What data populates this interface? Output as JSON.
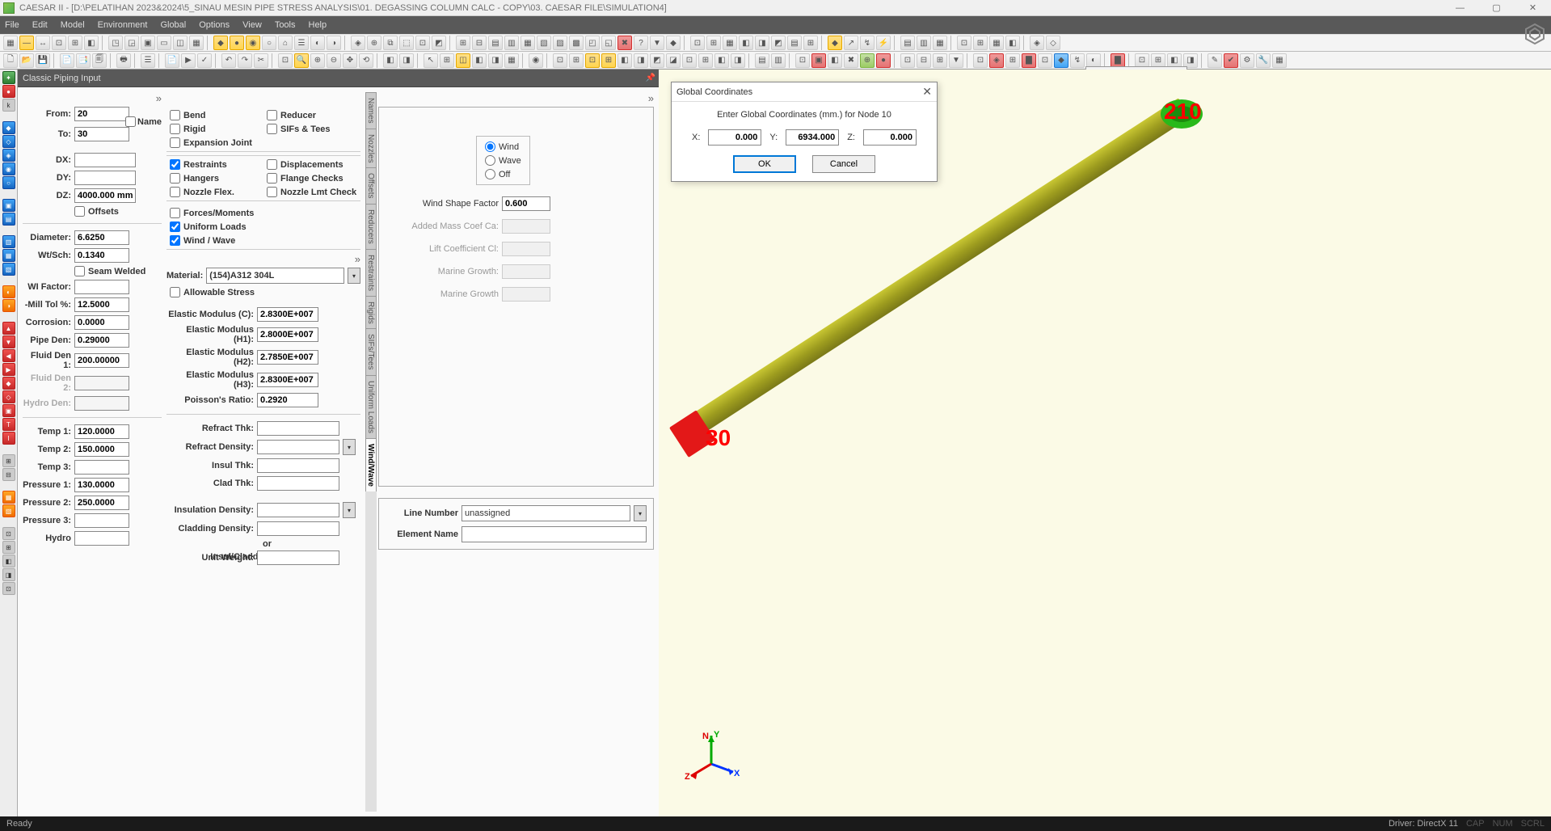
{
  "app": {
    "title": "CAESAR II - [D:\\PELATIHAN 2023&2024\\5_SINAU MESIN PIPE STRESS ANALYSIS\\01. DEGASSING COLUMN CALC - COPY\\03. CAESAR FILE\\SIMULATION4]"
  },
  "menu": [
    "File",
    "Edit",
    "Model",
    "Environment",
    "Global",
    "Options",
    "View",
    "Tools",
    "Help"
  ],
  "panel": {
    "title": "Classic Piping Input"
  },
  "from_to": {
    "from_lbl": "From:",
    "to_lbl": "To:",
    "from": "20",
    "to": "30",
    "name_lbl": "Name"
  },
  "deltas": {
    "dx_lbl": "DX:",
    "dy_lbl": "DY:",
    "dz_lbl": "DZ:",
    "dx": "",
    "dy": "",
    "dz": "4000.000 mm",
    "offsets_lbl": "Offsets"
  },
  "pipe": {
    "diameter_lbl": "Diameter:",
    "diameter": "6.6250",
    "wt_lbl": "Wt/Sch:",
    "wt": "0.1340",
    "seam_lbl": "Seam Welded",
    "wi_lbl": "WI Factor:",
    "wi": "",
    "mill_lbl": "-Mill Tol %:",
    "mill": "12.5000",
    "corr_lbl": "Corrosion:",
    "corr": "0.0000",
    "pden_lbl": "Pipe Den:",
    "pden": "0.29000",
    "fd1_lbl": "Fluid Den 1:",
    "fd1": "200.00000",
    "fd2_lbl": "Fluid Den 2:",
    "fd2": "",
    "hd_lbl": "Hydro Den:",
    "hd": ""
  },
  "tp": {
    "t1_lbl": "Temp 1:",
    "t1": "120.0000",
    "t2_lbl": "Temp 2:",
    "t2": "150.0000",
    "t3_lbl": "Temp 3:",
    "t3": "",
    "p1_lbl": "Pressure 1:",
    "p1": "130.0000",
    "p2_lbl": "Pressure 2:",
    "p2": "250.0000",
    "p3_lbl": "Pressure 3:",
    "p3": "",
    "hy_lbl": "Hydro",
    "hy": ""
  },
  "flags": {
    "bend": "Bend",
    "reducer": "Reducer",
    "rigid": "Rigid",
    "sifs": "SIFs & Tees",
    "exp": "Expansion Joint",
    "restraints": "Restraints",
    "disp": "Displacements",
    "hangers": "Hangers",
    "flange": "Flange Checks",
    "nozflex": "Nozzle Flex.",
    "nozlmt": "Nozzle Lmt Check",
    "forces": "Forces/Moments",
    "uloads": "Uniform Loads",
    "windwave": "Wind / Wave"
  },
  "material": {
    "lbl": "Material:",
    "val": "(154)A312 304L",
    "allow": "Allowable Stress",
    "ec_lbl": "Elastic Modulus (C):",
    "ec": "2.8300E+007",
    "eh1_lbl": "Elastic Modulus (H1):",
    "eh1": "2.8000E+007",
    "eh2_lbl": "Elastic Modulus (H2):",
    "eh2": "2.7850E+007",
    "eh3_lbl": "Elastic Modulus (H3):",
    "eh3": "2.8300E+007",
    "pr_lbl": "Poisson's Ratio:",
    "pr": "0.2920"
  },
  "ins": {
    "rt_lbl": "Refract Thk:",
    "rt": "",
    "rd_lbl": "Refract Density:",
    "rd": "",
    "it_lbl": "Insul Thk:",
    "it": "",
    "ct_lbl": "Clad Thk:",
    "ct": "",
    "id_lbl": "Insulation Density:",
    "id": "",
    "cd_lbl": "Cladding Density:",
    "cd": "",
    "or_lbl": "or",
    "ic_lbl": "Insul/Cladding",
    "uw_lbl": "Unit Weight:",
    "uw": ""
  },
  "side_tabs": [
    "Names",
    "Nozzles",
    "Offsets",
    "Reducers",
    "Restraints",
    "Rigids",
    "SIFs/Tees",
    "Uniform Loads",
    "Wind/Wave"
  ],
  "wind": {
    "r_wind": "Wind",
    "r_wave": "Wave",
    "r_off": "Off",
    "wsf_lbl": "Wind Shape Factor",
    "wsf": "0.600",
    "amc_lbl": "Added Mass Coef Ca:",
    "amc": "",
    "lc_lbl": "Lift Coefficient Cl:",
    "lc": "",
    "mg1_lbl": "Marine Growth:",
    "mg1": "",
    "mg2_lbl": "Marine Growth",
    "mg2": ""
  },
  "line": {
    "ln_lbl": "Line Number",
    "ln": "unassigned",
    "en_lbl": "Element Name",
    "en": ""
  },
  "modal": {
    "title": "Global Coordinates",
    "msg": "Enter Global Coordinates (mm.) for Node 10",
    "x_lbl": "X:",
    "x": "0.000",
    "y_lbl": "Y:",
    "y": "6934.000",
    "z_lbl": "Z:",
    "z": "0.000",
    "ok": "OK",
    "cancel": "Cancel"
  },
  "nodes": {
    "n30": "30",
    "n210": "210"
  },
  "gizmo": {
    "n": "N",
    "x": "X",
    "y": "Y",
    "z": "Z"
  },
  "status": {
    "ready": "Ready",
    "driver": "Driver: DirectX 11",
    "cap": "CAP",
    "num": "NUM",
    "scrl": "SCRL"
  }
}
